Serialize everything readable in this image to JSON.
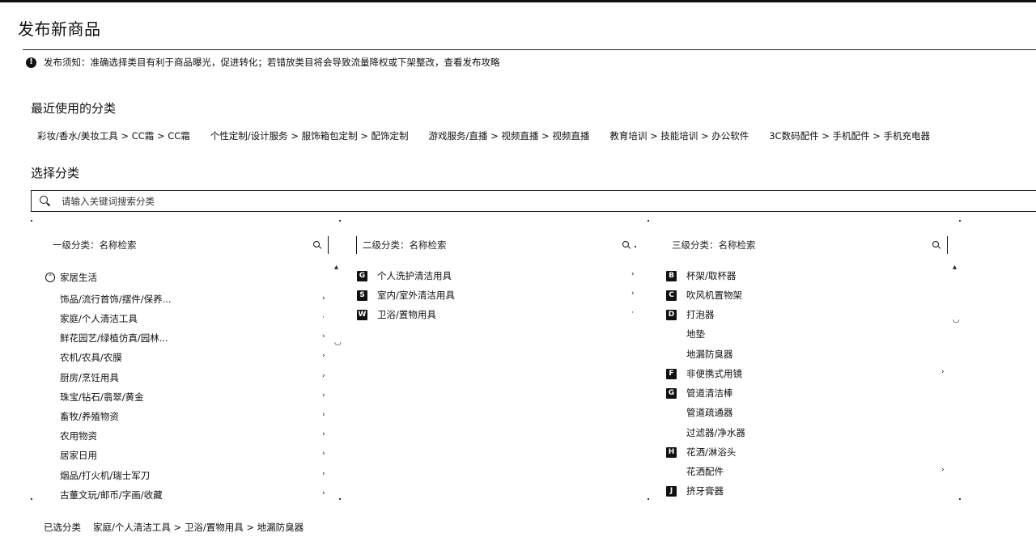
{
  "page": {
    "title": "发布新商品"
  },
  "notice": {
    "icon": "info-icon",
    "text": "发布须知：准确选择类目有利于商品曝光，促进转化；若错放类目将会导致流量降权或下架整改，查看发布攻略"
  },
  "recent": {
    "title": "最近使用的分类",
    "items": [
      "彩妆/香水/美妆工具 > CC霜 > CC霜",
      "个性定制/设计服务 > 服饰箱包定制 > 配饰定制",
      "游戏服务/直播 > 视频直播 > 视频直播",
      "教育培训 > 技能培训 > 办公软件",
      "3C数码配件 > 手机配件 > 手机充电器"
    ]
  },
  "choose": {
    "title": "选择分类",
    "search_placeholder": "请输入关键词搜索分类"
  },
  "columns": {
    "level1": {
      "placeholder": "一级分类：名称检索",
      "group": "家居生活",
      "items": [
        "饰品/流行首饰/摆件/保养...",
        "家庭/个人清洁工具",
        "鲜花园艺/绿植仿真/园林...",
        "农机/农具/农膜",
        "厨房/烹饪用具",
        "珠宝/钻石/翡翠/黄金",
        "畜牧/养殖物资",
        "农用物资",
        "居家日用",
        "烟品/打火机/瑞士军刀",
        "古董文玩/邮币/字画/收藏"
      ]
    },
    "level2": {
      "placeholder": "二级分类：名称检索",
      "items": [
        {
          "badge": "G",
          "label": "个人洗护清洁用具"
        },
        {
          "badge": "S",
          "label": "室内/室外清洁用具"
        },
        {
          "badge": "W",
          "label": "卫浴/置物用具"
        }
      ]
    },
    "level3": {
      "placeholder": "三级分类：名称检索",
      "items": [
        {
          "badge": "B",
          "label": "杯架/取杯器"
        },
        {
          "badge": "C",
          "label": "吹风机置物架"
        },
        {
          "badge": "D",
          "label": "打泡器"
        },
        {
          "badge": "",
          "label": "地垫"
        },
        {
          "badge": "",
          "label": "地漏防臭器"
        },
        {
          "badge": "F",
          "label": "非便携式用镜"
        },
        {
          "badge": "G",
          "label": "管道清洁棒"
        },
        {
          "badge": "",
          "label": "管道疏通器"
        },
        {
          "badge": "",
          "label": "过滤器/净水器"
        },
        {
          "badge": "H",
          "label": "花洒/淋浴头"
        },
        {
          "badge": "",
          "label": "花洒配件"
        },
        {
          "badge": "J",
          "label": "挤牙膏器"
        }
      ]
    }
  },
  "selected": {
    "label": "已选分类",
    "path": "家庭/个人清洁工具 > 卫浴/置物用具 > 地漏防臭器"
  }
}
